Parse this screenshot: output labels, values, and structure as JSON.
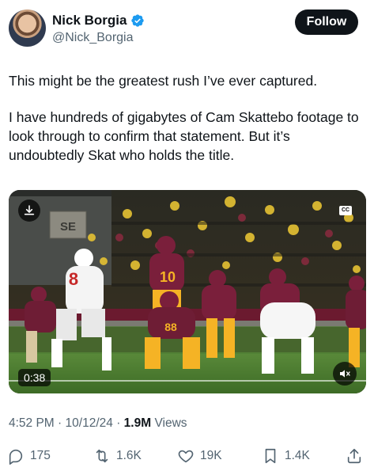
{
  "author": {
    "name": "Nick Borgia",
    "handle": "@Nick_Borgia",
    "verified_color": "#1d9bf0"
  },
  "follow_label": "Follow",
  "tweet": {
    "paragraphs": [
      "This might be the greatest rush I’ve ever captured.",
      "I have hundreds of gigabytes of Cam Skattebo footage to look through to confirm that statement. But it’s undoubtedly Skat who holds the title."
    ]
  },
  "media": {
    "type": "video",
    "duration": "0:38",
    "cc_label": "CC",
    "scoreboard_text": "SE",
    "jersey_numbers": [
      "8",
      "10",
      "88"
    ],
    "icons": {
      "download": "download-icon",
      "captions": "captions-icon",
      "mute": "volume-muted-icon"
    }
  },
  "meta": {
    "time": "4:52 PM",
    "separator": "·",
    "date": "10/12/24",
    "views_count": "1.9M",
    "views_label": "Views"
  },
  "actions": {
    "replies": "175",
    "retweets": "1.6K",
    "likes": "19K",
    "bookmarks": "1.4K",
    "icons": [
      "reply-icon",
      "retweet-icon",
      "like-icon",
      "bookmark-icon",
      "share-icon"
    ]
  },
  "colors": {
    "text_primary": "#0f1419",
    "text_secondary": "#536471",
    "follow_bg": "#0f1419",
    "verified": "#1d9bf0",
    "asu_maroon": "#7a1f3b",
    "asu_gold": "#f5b325"
  }
}
